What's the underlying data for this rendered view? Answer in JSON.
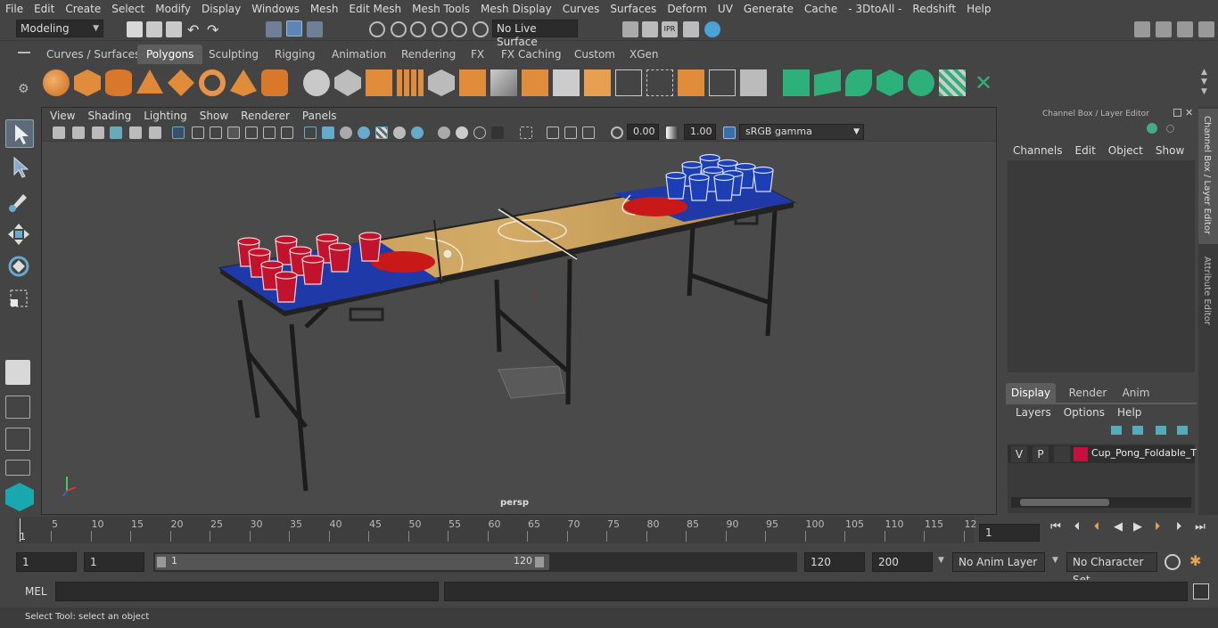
{
  "menu": [
    "File",
    "Edit",
    "Create",
    "Select",
    "Modify",
    "Display",
    "Windows",
    "Mesh",
    "Edit Mesh",
    "Mesh Tools",
    "Mesh Display",
    "Curves",
    "Surfaces",
    "Deform",
    "UV",
    "Generate",
    "Cache",
    "- 3DtoAll -",
    "Redshift",
    "Help"
  ],
  "status": {
    "workspace": "Modeling",
    "live_surface": "No Live Surface"
  },
  "shelf_tabs": [
    "Curves / Surfaces",
    "Polygons",
    "Sculpting",
    "Rigging",
    "Animation",
    "Rendering",
    "FX",
    "FX Caching",
    "Custom",
    "XGen"
  ],
  "shelf_active": "Polygons",
  "viewport": {
    "menu": [
      "View",
      "Shading",
      "Lighting",
      "Show",
      "Renderer",
      "Panels"
    ],
    "exposure": "0.00",
    "gamma": "1.00",
    "colorspace": "sRGB gamma",
    "camera_label": "persp"
  },
  "channel_box": {
    "title": "Channel Box / Layer Editor",
    "menu": [
      "Channels",
      "Edit",
      "Object",
      "Show"
    ],
    "tabs": [
      "Display",
      "Render",
      "Anim"
    ],
    "active_tab": "Display",
    "layer_menu": [
      "Layers",
      "Options",
      "Help"
    ],
    "layer": {
      "v": "V",
      "p": "P",
      "name": "Cup_Pong_Foldable_T",
      "color": "#c4123a"
    }
  },
  "side_tabs": [
    "Channel Box / Layer Editor",
    "Attribute Editor"
  ],
  "timeline": {
    "ticks": [
      "5",
      "10",
      "15",
      "20",
      "25",
      "30",
      "35",
      "40",
      "45",
      "50",
      "55",
      "60",
      "65",
      "70",
      "75",
      "80",
      "85",
      "90",
      "95",
      "100",
      "105",
      "110",
      "115",
      "12"
    ],
    "start_marker": "1",
    "current_frame": "1"
  },
  "range": {
    "start": "1",
    "inner_start": "1",
    "slider_start": "1",
    "slider_end": "120",
    "end": "120",
    "anim_end": "200",
    "anim_layer": "No Anim Layer",
    "character_set": "No Character Set"
  },
  "cmd": {
    "label": "MEL"
  },
  "help_line": "Select Tool: select an object"
}
